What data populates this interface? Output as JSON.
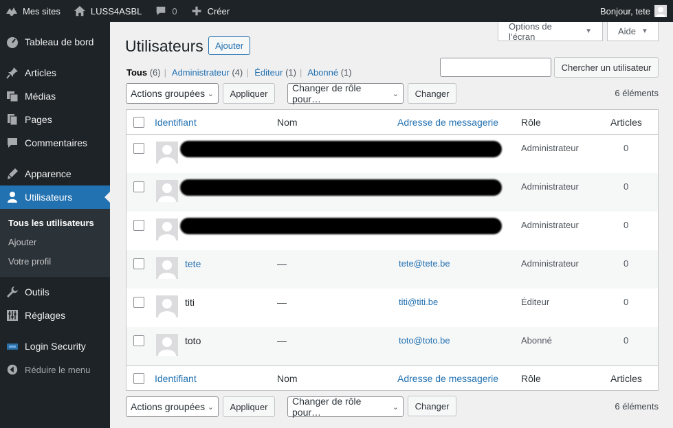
{
  "adminbar": {
    "my_sites": "Mes sites",
    "site_name": "LUSS4ASBL",
    "comments_count": "0",
    "new_label": "Créer",
    "greeting": "Bonjour, tete"
  },
  "sidebar": {
    "items": [
      {
        "label": "Tableau de bord",
        "icon": "dashboard-icon"
      },
      {
        "label": "Articles",
        "icon": "pin-icon"
      },
      {
        "label": "Médias",
        "icon": "media-icon"
      },
      {
        "label": "Pages",
        "icon": "pages-icon"
      },
      {
        "label": "Commentaires",
        "icon": "comments-icon"
      },
      {
        "label": "Apparence",
        "icon": "appearance-icon"
      },
      {
        "label": "Utilisateurs",
        "icon": "users-icon"
      },
      {
        "label": "Outils",
        "icon": "tools-icon"
      },
      {
        "label": "Réglages",
        "icon": "settings-icon"
      },
      {
        "label": "Login Security",
        "icon": "login-security-icon"
      }
    ],
    "submenu": [
      "Tous les utilisateurs",
      "Ajouter",
      "Votre profil"
    ],
    "collapse": "Réduire le menu"
  },
  "screen_options": {
    "options": "Options de l’écran",
    "help": "Aide"
  },
  "page": {
    "title": "Utilisateurs",
    "add_button": "Ajouter",
    "views": [
      {
        "label": "Tous",
        "count": "(6)"
      },
      {
        "label": "Administrateur",
        "count": "(4)"
      },
      {
        "label": "Éditeur",
        "count": "(1)"
      },
      {
        "label": "Abonné",
        "count": "(1)"
      }
    ],
    "search_value": "",
    "search_button": "Chercher un utilisateur"
  },
  "tablenav": {
    "bulk_actions": "Actions groupées",
    "apply": "Appliquer",
    "change_role": "Changer de rôle pour…",
    "change": "Changer",
    "count": "6 éléments"
  },
  "table": {
    "columns": [
      "Identifiant",
      "Nom",
      "Adresse de messagerie",
      "Rôle",
      "Articles"
    ],
    "rows": [
      {
        "username": "",
        "name": "",
        "email": "",
        "role": "Administrateur",
        "posts": "0"
      },
      {
        "username": "",
        "name": "",
        "email": "",
        "role": "Administrateur",
        "posts": "0"
      },
      {
        "username": "",
        "name": "",
        "email": "",
        "role": "Administrateur",
        "posts": "0"
      },
      {
        "username": "tete",
        "name": "—",
        "email": "tete@tete.be",
        "role": "Administrateur",
        "posts": "0"
      },
      {
        "username": "titi",
        "name": "—",
        "email": "titi@titi.be",
        "role": "Éditeur",
        "posts": "0"
      },
      {
        "username": "toto",
        "name": "—",
        "email": "toto@toto.be",
        "role": "Abonné",
        "posts": "0"
      }
    ]
  },
  "colors": {
    "accent": "#2271b1",
    "sidebar": "#1d2327",
    "background": "#f0f0f1"
  }
}
